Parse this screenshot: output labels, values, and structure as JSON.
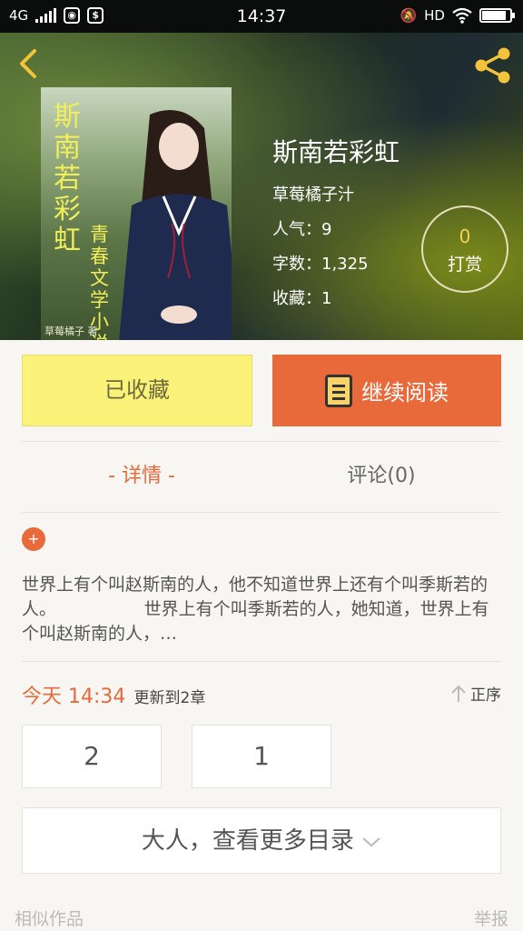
{
  "status_bar": {
    "network": "4G",
    "time": "14:37",
    "hd": "HD",
    "battery_level": 0.85
  },
  "header": {
    "back_icon": "chevron-left-icon",
    "share_icon": "share-icon",
    "accent_color": "#f3c33a"
  },
  "book": {
    "title": "斯南若彩虹",
    "author": "草莓橘子汁",
    "popularity": "人气：9",
    "word_count": "字数：1,325",
    "favorites": "收藏：1",
    "cover_text_1": "斯南若彩虹",
    "cover_text_2": "青春文学小说",
    "cover_caption": "草莓橘子  著"
  },
  "tip": {
    "count": "0",
    "label": "打赏"
  },
  "actions": {
    "collected_label": "已收藏",
    "continue_label": "继续阅读"
  },
  "tabs": {
    "detail": "- 详情 -",
    "comments": "评论(0)"
  },
  "synopsis": "世界上有个叫赵斯南的人，他不知道世界上还有个叫季斯若的人。                世界上有个叫季斯若的人，她知道，世界上有个叫赵斯南的人，…",
  "update": {
    "time": "今天 14:34",
    "text": "更新到2章",
    "sort_label": "正序"
  },
  "chapters": [
    "2",
    "1"
  ],
  "more_toc_label": "大人，查看更多目录",
  "footer": {
    "similar": "相似作品",
    "report": "举报"
  },
  "colors": {
    "orange": "#e8693a",
    "yellow_button": "#fbf27a",
    "background": "#f7f6f3"
  }
}
